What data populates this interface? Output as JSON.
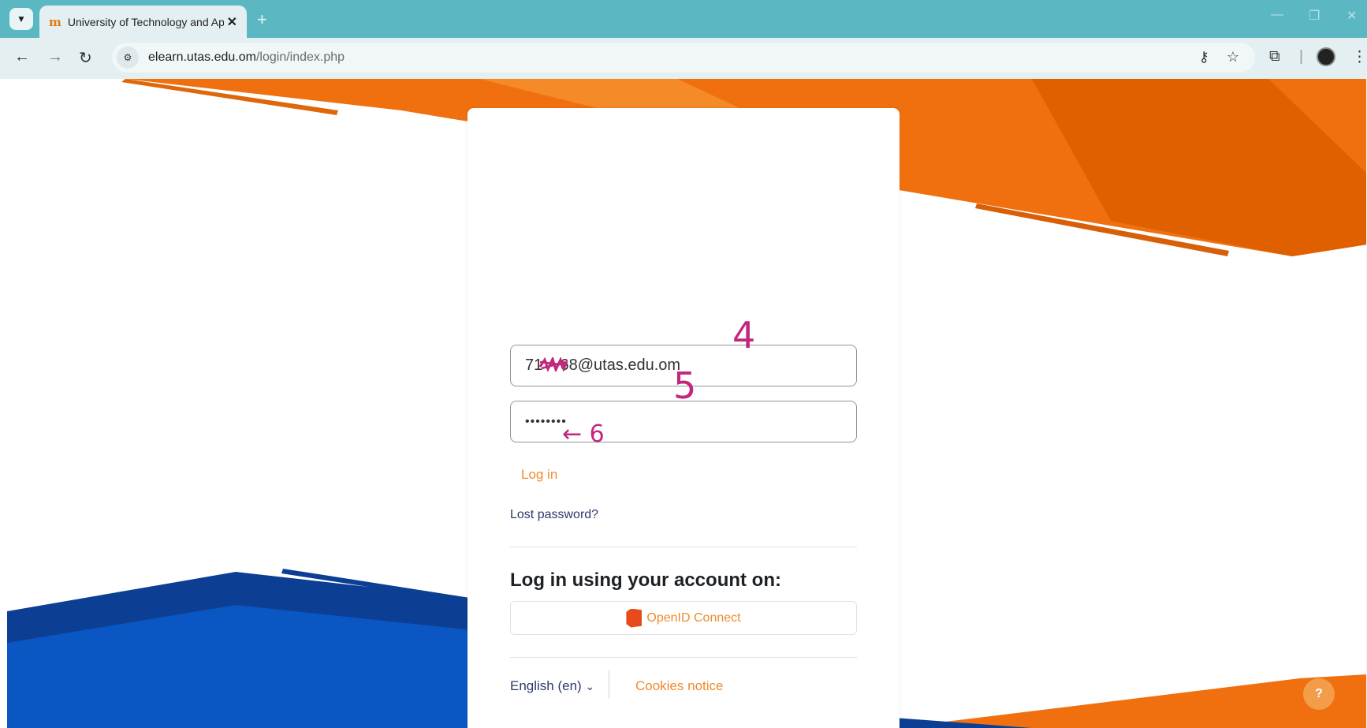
{
  "browser": {
    "tab_title": "University of Technology and Applied Sciences",
    "favicon": "m",
    "tab_close": "✕",
    "new_tab": "+",
    "address_host": "elearn.utas.edu.om",
    "address_path": "/login/index.php",
    "win_minimize": "—",
    "win_restore": "❐",
    "win_close": "✕"
  },
  "login": {
    "username_value": "71    68@utas.edu.om",
    "password_value": "••••••••",
    "login_label": "Log in",
    "lost_password": "Lost password?",
    "heading": "Log in using your account on:",
    "provider_label": "OpenID Connect",
    "language": "English (en)",
    "language_chevron": "⌄",
    "cookies": "Cookies notice"
  },
  "annotations": {
    "a4": "4",
    "a5": "5",
    "a6": "← 6"
  },
  "help": {
    "label": "?"
  },
  "colors": {
    "chrome_accent": "#5bb8c3",
    "brand_orange": "#f07010",
    "brand_blue": "#0a4aa0",
    "link_orange": "#f08a2c",
    "annotation": "#c2267e"
  }
}
